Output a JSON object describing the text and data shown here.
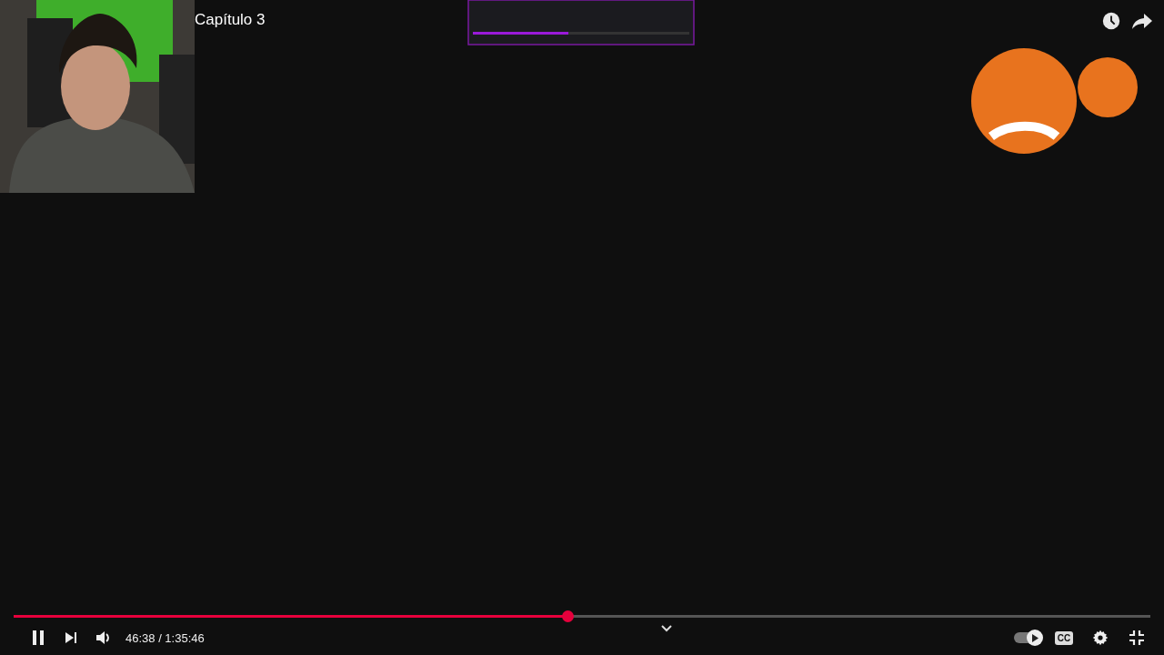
{
  "title": "Capítulo 3",
  "top_actions": [
    {
      "kind": "clock"
    },
    {
      "kind": "share"
    }
  ],
  "progress": {
    "level": 0.487
  },
  "left_controls": [
    {
      "kind": "pause"
    },
    {
      "kind": "next"
    },
    {
      "kind": "volume"
    }
  ],
  "time": "46:38 / 1:35:46",
  "center_control": {
    "kind": "chevron"
  },
  "right_controls": [
    {
      "kind": "autoplay",
      "on": true
    },
    {
      "kind": "captions",
      "label": "CC"
    },
    {
      "kind": "settings"
    },
    {
      "kind": "exit-fullscreen"
    }
  ]
}
